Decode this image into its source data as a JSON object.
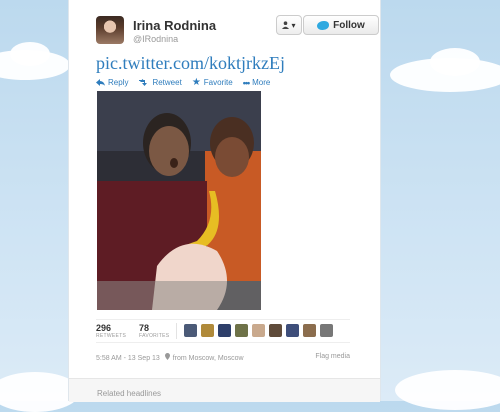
{
  "user": {
    "name": "Irina Rodnina",
    "handle": "@IRodnina"
  },
  "header_buttons": {
    "user_dropdown_label": "▾",
    "follow_label": "Follow"
  },
  "tweet": {
    "link_text": "pic.twitter.com/koktjrkzEj",
    "actions": {
      "reply": "Reply",
      "retweet": "Retweet",
      "favorite": "Favorite",
      "more": "More"
    },
    "stats": {
      "retweets": "296",
      "retweets_label": "RETWEETS",
      "favorites": "78",
      "favorites_label": "FAVORITES"
    },
    "meta": {
      "timestamp": "5:58 AM - 13 Sep 13",
      "location": "from Moscow, Moscow",
      "flag": "Flag media"
    }
  },
  "related": {
    "title": "Related headlines"
  },
  "colors": {
    "link_blue": "#2f7dbd",
    "background_sky": "#c6dff2",
    "twitter_bird": "#2fa9e0"
  },
  "icons": [
    "reply-icon",
    "retweet-icon",
    "favorite-icon",
    "more-icon",
    "location-icon",
    "twitter-bird-icon",
    "user-icon"
  ]
}
